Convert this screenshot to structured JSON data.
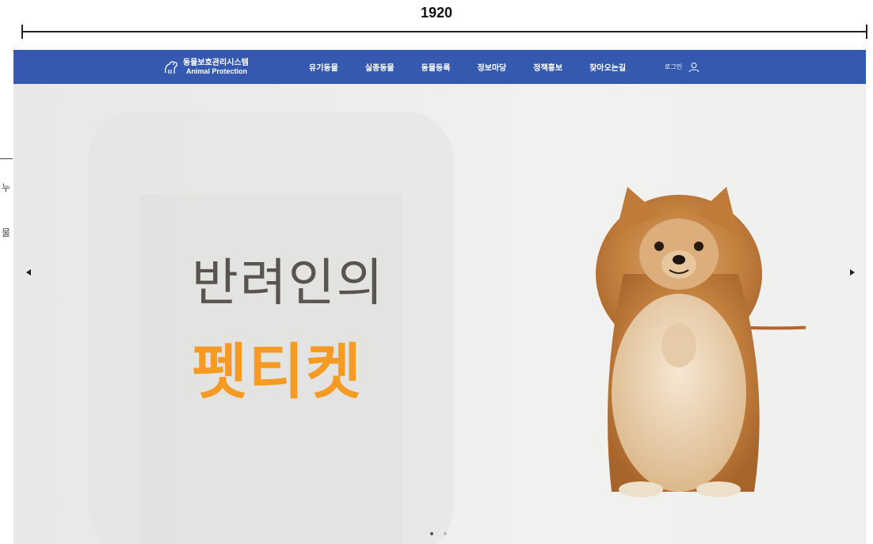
{
  "annotation": {
    "width_label": "1920",
    "side_glyph_1": "누",
    "side_glyph_2": "물"
  },
  "header": {
    "logo_kr": "동물보호관리시스템",
    "logo_en": "Animal Protection",
    "menu": [
      {
        "label": "유기동물"
      },
      {
        "label": "실종동물"
      },
      {
        "label": "동물등록"
      },
      {
        "label": "정보마당"
      },
      {
        "label": "정책홍보"
      },
      {
        "label": "찾아오는길"
      }
    ],
    "login_label": "로그인",
    "icons": {
      "logo": "animal-logo-icon",
      "user": "user-icon"
    }
  },
  "hero": {
    "headline_line1": "반려인의",
    "headline_line2": "펫티켓",
    "prev_icon": "triangle-left-icon",
    "next_icon": "triangle-right-icon",
    "slide_count": 2,
    "active_slide": 1
  },
  "colors": {
    "navbar": "#3459ae",
    "accent_orange": "#f59a23",
    "headline_gray": "#5a5450",
    "dot_active": "#555555",
    "dot_inactive": "#bbbbbb"
  }
}
